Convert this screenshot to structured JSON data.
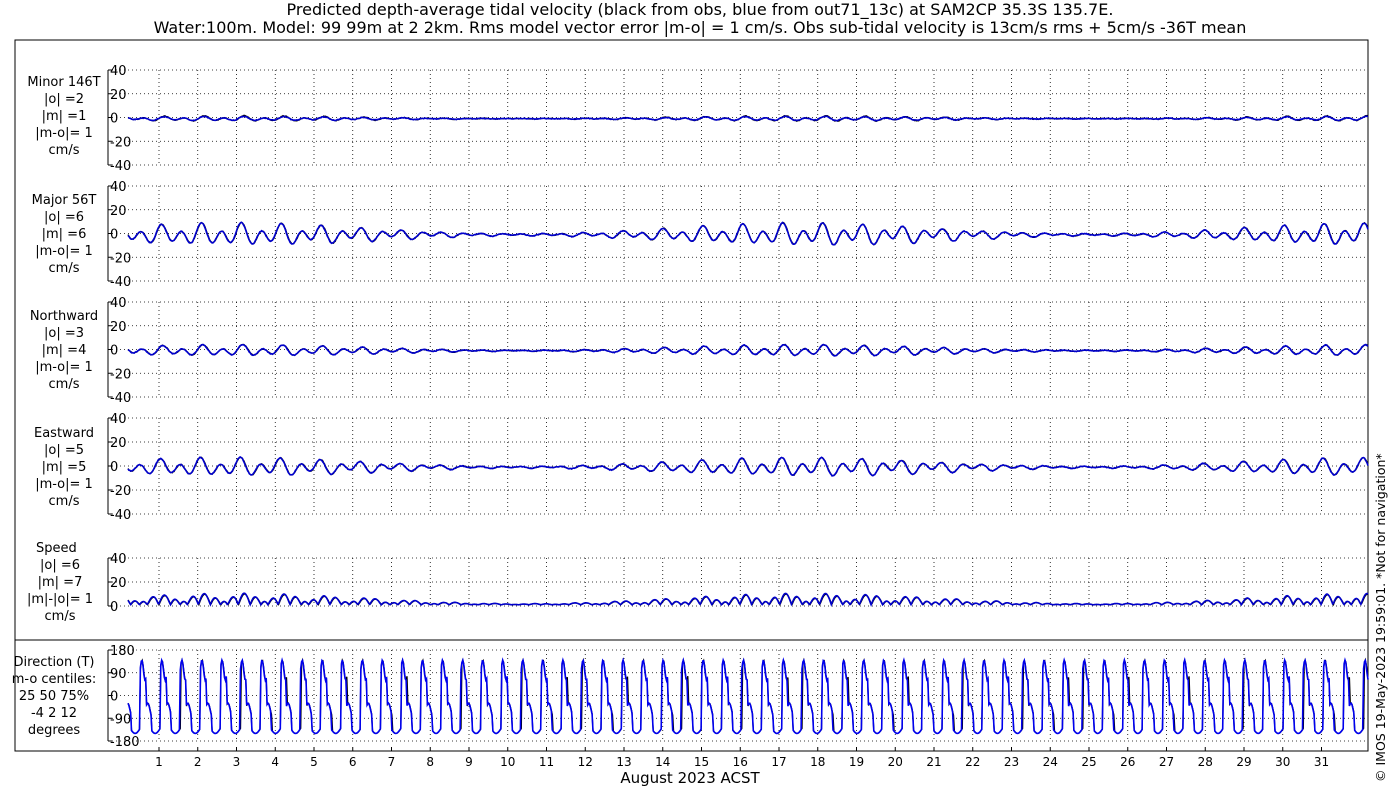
{
  "header": {
    "title_line1": "Predicted depth-average tidal velocity (black from obs, blue from out71_13c) at SAM2CP 35.3S 135.7E.",
    "title_line2": "Water:100m. Model: 99 99m at 2 2km. Rms model vector error |m-o| = 1 cm/s. Obs sub-tidal velocity is 13cm/s rms + 5cm/s -36T mean"
  },
  "footer": {
    "xlabel": "August 2023 ACST",
    "stamp": "© IMOS 19-May-2023 19:59:01. *Not for navigation*"
  },
  "panels": [
    {
      "id": "minor",
      "lines": [
        "Minor 146T",
        "|o| =2",
        "|m| =1",
        "|m-o|= 1",
        "cm/s"
      ]
    },
    {
      "id": "major",
      "lines": [
        "Major 56T",
        "|o| =6",
        "|m| =6",
        "|m-o|= 1",
        "cm/s"
      ]
    },
    {
      "id": "northward",
      "lines": [
        "Northward",
        "|o| =3",
        "|m| =4",
        "|m-o|= 1",
        "cm/s"
      ]
    },
    {
      "id": "eastward",
      "lines": [
        "Eastward",
        "|o| =5",
        "|m| =5",
        "|m-o|= 1",
        "cm/s"
      ]
    },
    {
      "id": "speed",
      "lines": [
        "Speed",
        "|o| =6",
        "|m| =7",
        "|m|-|o|= 1",
        "cm/s"
      ]
    },
    {
      "id": "direction",
      "lines": [
        "Direction (T)",
        "m-o centiles:",
        "25  50  75%",
        "-4   2  12",
        "degrees"
      ]
    }
  ],
  "chart_data": [
    {
      "type": "line",
      "id": "minor",
      "ylabel": "Minor 146T",
      "ylim": [
        -40,
        40
      ],
      "yticks": [
        "40",
        "20",
        "0",
        "-20",
        "-40"
      ],
      "grid": true,
      "series": [
        {
          "source": "obs",
          "color": "#000000",
          "amplitude": 2,
          "mean": -1
        },
        {
          "source": "model",
          "color": "#0000cc",
          "amplitude": 1.5,
          "mean": -1
        }
      ]
    },
    {
      "type": "line",
      "id": "major",
      "ylabel": "Major 56T",
      "ylim": [
        -40,
        40
      ],
      "yticks": [
        "40",
        "20",
        "0",
        "-20",
        "-40"
      ],
      "grid": true,
      "series": [
        {
          "source": "obs",
          "color": "#000000",
          "amplitude": 8,
          "mean": -1
        },
        {
          "source": "model",
          "color": "#0000cc",
          "amplitude": 8,
          "mean": -1
        }
      ]
    },
    {
      "type": "line",
      "id": "northward",
      "ylabel": "Northward",
      "ylim": [
        -40,
        40
      ],
      "yticks": [
        "40",
        "20",
        "0",
        "-20",
        "-40"
      ],
      "grid": true,
      "series": [
        {
          "source": "obs",
          "color": "#000000",
          "amplitude": 4,
          "mean": -1
        },
        {
          "source": "model",
          "color": "#0000cc",
          "amplitude": 4,
          "mean": -1
        }
      ]
    },
    {
      "type": "line",
      "id": "eastward",
      "ylabel": "Eastward",
      "ylim": [
        -40,
        40
      ],
      "yticks": [
        "40",
        "20",
        "0",
        "-20",
        "-40"
      ],
      "grid": true,
      "series": [
        {
          "source": "obs",
          "color": "#000000",
          "amplitude": 6.5,
          "mean": -1
        },
        {
          "source": "model",
          "color": "#0000cc",
          "amplitude": 6.5,
          "mean": -1
        }
      ]
    },
    {
      "type": "line",
      "id": "speed",
      "ylabel": "Speed",
      "ylim": [
        0,
        40
      ],
      "yticks": [
        "40",
        "20",
        "0"
      ],
      "grid": true,
      "series": [
        {
          "source": "obs",
          "color": "#000000",
          "amplitude": 7
        },
        {
          "source": "model",
          "color": "#0000cc",
          "amplitude": 7.5
        }
      ]
    },
    {
      "type": "line",
      "id": "direction",
      "ylabel": "Direction (T)",
      "ylim": [
        -180,
        180
      ],
      "yticks": [
        "180",
        "90",
        "0",
        "-90",
        "-180"
      ],
      "grid": true,
      "series": [
        {
          "source": "obs",
          "color": "#000000"
        },
        {
          "source": "model",
          "color": "#0000ee"
        }
      ]
    }
  ],
  "xaxis": {
    "start_day": 0.2,
    "end_day": 32.2,
    "ticks": [
      "1",
      "2",
      "3",
      "4",
      "5",
      "6",
      "7",
      "8",
      "9",
      "10",
      "11",
      "12",
      "13",
      "14",
      "15",
      "16",
      "17",
      "18",
      "19",
      "20",
      "21",
      "22",
      "23",
      "24",
      "25",
      "26",
      "27",
      "28",
      "29",
      "30",
      "31"
    ]
  }
}
